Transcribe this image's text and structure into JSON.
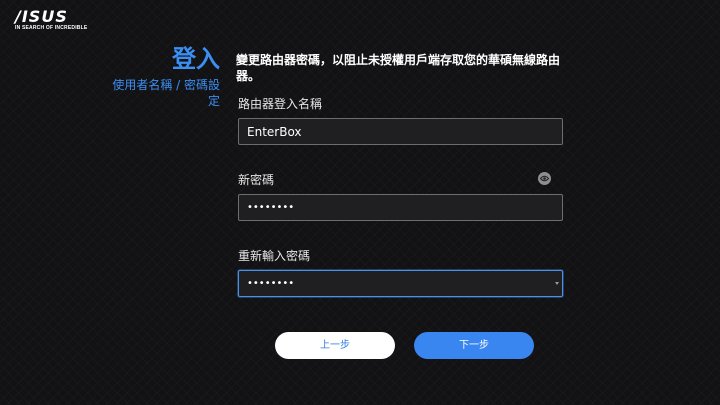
{
  "brand": {
    "logo_text": "/ISUS",
    "tagline": "IN SEARCH OF INCREDIBLE"
  },
  "side": {
    "title": "登入",
    "subtitle": "使用者名稱 / 密碼設定"
  },
  "description": "變更路由器密碼，以阻止未授權用戶端存取您的華碩無線路由器。",
  "form": {
    "username_label": "路由器登入名稱",
    "username_value": "EnterBox",
    "new_password_label": "新密碼",
    "new_password_value": "••••••••",
    "confirm_password_label": "重新輸入密碼",
    "confirm_password_value": "••••••••"
  },
  "buttons": {
    "prev_label": "上一步",
    "next_label": "下一步"
  },
  "icons": {
    "show_password": "eye-icon",
    "dropdown": "caret-down-icon"
  },
  "colors": {
    "accent": "#3b8ff2",
    "background": "#121214",
    "input_background": "#1f1f21",
    "next_button": "#3a86f0",
    "prev_button": "#ffffff"
  }
}
